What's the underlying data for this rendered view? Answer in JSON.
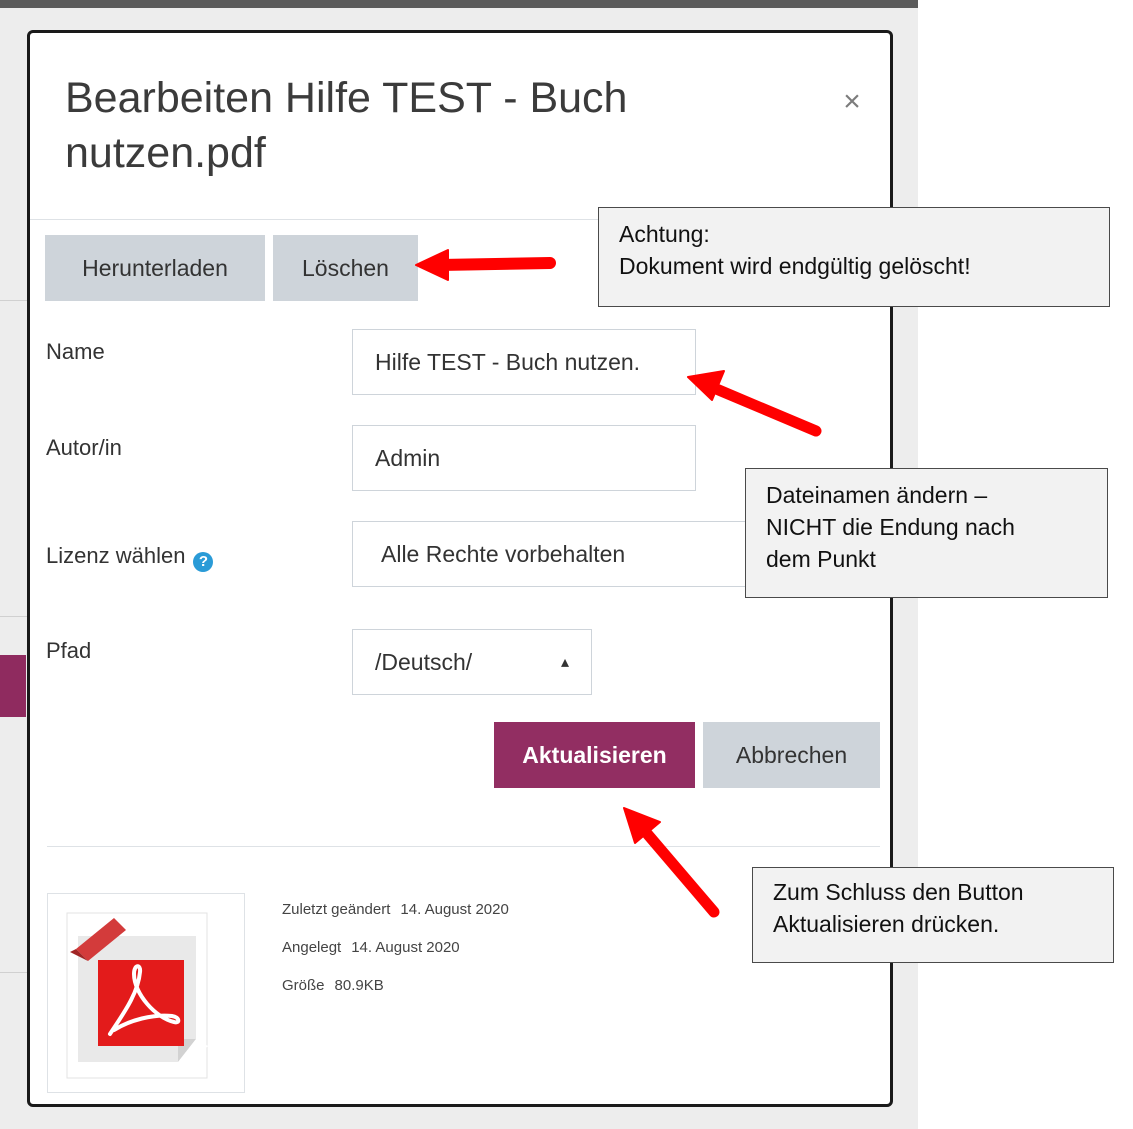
{
  "modal": {
    "title": "Bearbeiten Hilfe TEST - Buch nutzen.pdf",
    "close_glyph": "×"
  },
  "actions": {
    "download_label": "Herunterladen",
    "delete_label": "Löschen"
  },
  "form": {
    "name_label": "Name",
    "name_value": "Hilfe TEST - Buch nutzen.",
    "author_label": "Autor/in",
    "author_value": "Admin",
    "license_label": "Lizenz wählen",
    "license_value": "Alle Rechte vorbehalten",
    "path_label": "Pfad",
    "path_value": "/Deutsch/"
  },
  "buttons": {
    "update_label": "Aktualisieren",
    "cancel_label": "Abbrechen"
  },
  "file_info": {
    "modified_label": "Zuletzt geändert",
    "modified_value": "14. August 2020",
    "created_label": "Angelegt",
    "created_value": "14. August 2020",
    "size_label": "Größe",
    "size_value": "80.9KB",
    "icon": "pdf-file-icon"
  },
  "callouts": {
    "delete_warning": [
      "Achtung:",
      "Dokument wird endgültig gelöscht!"
    ],
    "rename_hint": [
      "Dateinamen ändern –",
      "NICHT die Endung nach",
      "dem Punkt"
    ],
    "update_hint": [
      "Zum Schluss den Button",
      "Aktualisieren drücken."
    ]
  },
  "colors": {
    "primary": "#922e62",
    "arrow": "#ff0000",
    "help_icon": "#2a9bd7"
  }
}
